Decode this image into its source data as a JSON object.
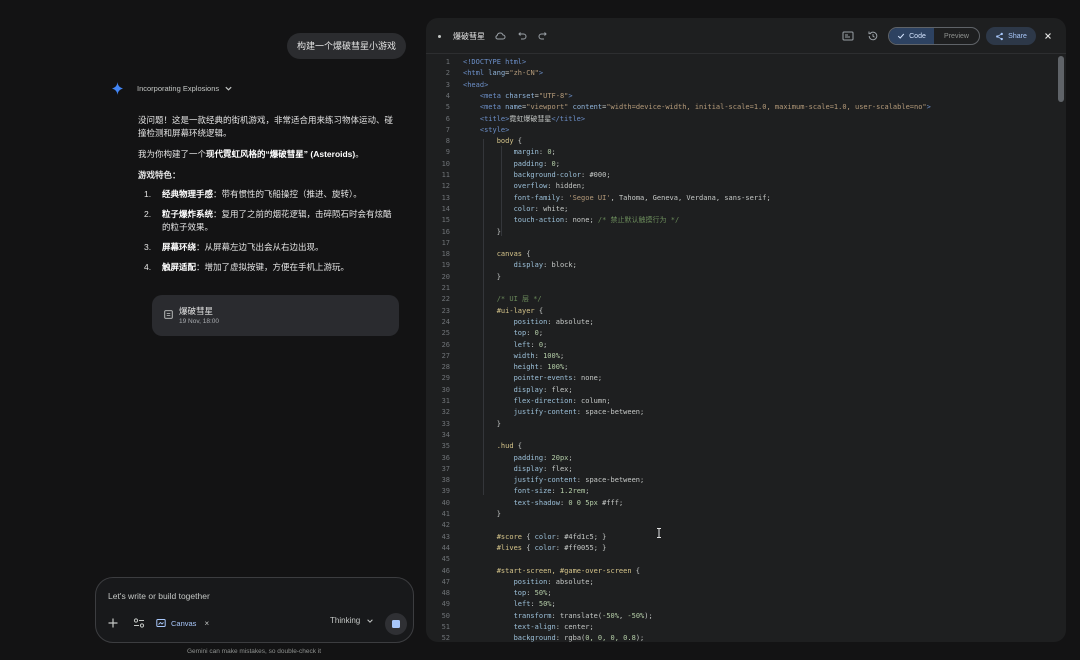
{
  "chat": {
    "user_prompt": "构建一个爆破彗星小游戏",
    "thinking_label": "Incorporating Explosions",
    "response": {
      "intro": "没问题！这是一款经典的街机游戏，非常适合用来练习物体运动、碰撞检测和屏幕环绕逻辑。",
      "lead": "我为你构建了一个",
      "lead_bold": "现代霓虹风格的“爆破彗星” (Asteroids)",
      "lead_end": "。",
      "features_heading": "游戏特色：",
      "features": [
        {
          "num": "1.",
          "title": "经典物理手感",
          "text": "：带有惯性的飞船操控（推进、旋转）。"
        },
        {
          "num": "2.",
          "title": "粒子爆炸系统",
          "text": "：复用了之前的烟花逻辑，击碎陨石时会有炫酷的粒子效果。"
        },
        {
          "num": "3.",
          "title": "屏幕环绕",
          "text": "：从屏幕左边飞出会从右边出现。"
        },
        {
          "num": "4.",
          "title": "触屏适配",
          "text": "：增加了虚拟按键，方便在手机上游玩。"
        }
      ]
    },
    "canvas_card": {
      "title": "爆破彗星",
      "date": "19 Nov, 18:00"
    },
    "input": {
      "placeholder": "Let's write or build together"
    },
    "chip_label": "Canvas",
    "mode_label": "Thinking",
    "disclaimer": "Gemini can make mistakes, so double-check it"
  },
  "editor": {
    "title": "爆破彗星",
    "tabs": {
      "code": "Code",
      "preview": "Preview"
    },
    "share_label": "Share",
    "lines": [
      [
        [
          "t-tag",
          "<!DOCTYPE html>"
        ]
      ],
      [
        [
          "t-tag",
          "<html "
        ],
        [
          "t-attr",
          "lang"
        ],
        [
          "t-pun",
          "="
        ],
        [
          "t-str",
          "\"zh-CN\""
        ],
        [
          "t-tag",
          ">"
        ]
      ],
      [
        [
          "t-tag",
          "<head>"
        ]
      ],
      [
        [
          "t-pun",
          "    "
        ],
        [
          "t-tag",
          "<meta "
        ],
        [
          "t-attr",
          "charset"
        ],
        [
          "t-pun",
          "="
        ],
        [
          "t-str",
          "\"UTF-8\""
        ],
        [
          "t-tag",
          ">"
        ]
      ],
      [
        [
          "t-pun",
          "    "
        ],
        [
          "t-tag",
          "<meta "
        ],
        [
          "t-attr",
          "name"
        ],
        [
          "t-pun",
          "="
        ],
        [
          "t-str",
          "\"viewport\""
        ],
        [
          "t-pun",
          " "
        ],
        [
          "t-attr",
          "content"
        ],
        [
          "t-pun",
          "="
        ],
        [
          "t-str",
          "\"width=device-width, initial-scale=1.0, maximum-scale=1.0, user-scalable=no\""
        ],
        [
          "t-tag",
          ">"
        ]
      ],
      [
        [
          "t-pun",
          "    "
        ],
        [
          "t-tag",
          "<title>"
        ],
        [
          "t-val",
          "霓虹爆破彗星"
        ],
        [
          "t-tag",
          "</title>"
        ]
      ],
      [
        [
          "t-pun",
          "    "
        ],
        [
          "t-tag",
          "<style>"
        ]
      ],
      [
        [
          "t-pun",
          "        "
        ],
        [
          "t-sel",
          "body"
        ],
        [
          "t-pun",
          " {"
        ]
      ],
      [
        [
          "t-pun",
          "            "
        ],
        [
          "t-prop",
          "margin"
        ],
        [
          "t-pun",
          ": "
        ],
        [
          "t-num",
          "0"
        ],
        [
          "t-pun",
          ";"
        ]
      ],
      [
        [
          "t-pun",
          "            "
        ],
        [
          "t-prop",
          "padding"
        ],
        [
          "t-pun",
          ": "
        ],
        [
          "t-num",
          "0"
        ],
        [
          "t-pun",
          ";"
        ]
      ],
      [
        [
          "t-pun",
          "            "
        ],
        [
          "t-prop",
          "background-color"
        ],
        [
          "t-pun",
          ": "
        ],
        [
          "t-val",
          "#000"
        ],
        [
          "t-pun",
          ";"
        ]
      ],
      [
        [
          "t-pun",
          "            "
        ],
        [
          "t-prop",
          "overflow"
        ],
        [
          "t-pun",
          ": "
        ],
        [
          "t-val",
          "hidden"
        ],
        [
          "t-pun",
          ";"
        ]
      ],
      [
        [
          "t-pun",
          "            "
        ],
        [
          "t-prop",
          "font-family"
        ],
        [
          "t-pun",
          ": "
        ],
        [
          "t-str",
          "'Segoe UI'"
        ],
        [
          "t-pun",
          ", "
        ],
        [
          "t-val",
          "Tahoma, Geneva, Verdana, sans-serif"
        ],
        [
          "t-pun",
          ";"
        ]
      ],
      [
        [
          "t-pun",
          "            "
        ],
        [
          "t-prop",
          "color"
        ],
        [
          "t-pun",
          ": "
        ],
        [
          "t-val",
          "white"
        ],
        [
          "t-pun",
          ";"
        ]
      ],
      [
        [
          "t-pun",
          "            "
        ],
        [
          "t-prop",
          "touch-action"
        ],
        [
          "t-pun",
          ": "
        ],
        [
          "t-val",
          "none"
        ],
        [
          "t-pun",
          "; "
        ],
        [
          "t-com",
          "/* 禁止默认触摸行为 */"
        ]
      ],
      [
        [
          "t-pun",
          "        }"
        ]
      ],
      [
        [
          "t-pun",
          ""
        ]
      ],
      [
        [
          "t-pun",
          "        "
        ],
        [
          "t-sel",
          "canvas"
        ],
        [
          "t-pun",
          " {"
        ]
      ],
      [
        [
          "t-pun",
          "            "
        ],
        [
          "t-prop",
          "display"
        ],
        [
          "t-pun",
          ": "
        ],
        [
          "t-val",
          "block"
        ],
        [
          "t-pun",
          ";"
        ]
      ],
      [
        [
          "t-pun",
          "        }"
        ]
      ],
      [
        [
          "t-pun",
          ""
        ]
      ],
      [
        [
          "t-pun",
          "        "
        ],
        [
          "t-com",
          "/* UI 层 */"
        ]
      ],
      [
        [
          "t-pun",
          "        "
        ],
        [
          "t-sel",
          "#ui-layer"
        ],
        [
          "t-pun",
          " {"
        ]
      ],
      [
        [
          "t-pun",
          "            "
        ],
        [
          "t-prop",
          "position"
        ],
        [
          "t-pun",
          ": "
        ],
        [
          "t-val",
          "absolute"
        ],
        [
          "t-pun",
          ";"
        ]
      ],
      [
        [
          "t-pun",
          "            "
        ],
        [
          "t-prop",
          "top"
        ],
        [
          "t-pun",
          ": "
        ],
        [
          "t-num",
          "0"
        ],
        [
          "t-pun",
          ";"
        ]
      ],
      [
        [
          "t-pun",
          "            "
        ],
        [
          "t-prop",
          "left"
        ],
        [
          "t-pun",
          ": "
        ],
        [
          "t-num",
          "0"
        ],
        [
          "t-pun",
          ";"
        ]
      ],
      [
        [
          "t-pun",
          "            "
        ],
        [
          "t-prop",
          "width"
        ],
        [
          "t-pun",
          ": "
        ],
        [
          "t-num",
          "100%"
        ],
        [
          "t-pun",
          ";"
        ]
      ],
      [
        [
          "t-pun",
          "            "
        ],
        [
          "t-prop",
          "height"
        ],
        [
          "t-pun",
          ": "
        ],
        [
          "t-num",
          "100%"
        ],
        [
          "t-pun",
          ";"
        ]
      ],
      [
        [
          "t-pun",
          "            "
        ],
        [
          "t-prop",
          "pointer-events"
        ],
        [
          "t-pun",
          ": "
        ],
        [
          "t-val",
          "none"
        ],
        [
          "t-pun",
          ";"
        ]
      ],
      [
        [
          "t-pun",
          "            "
        ],
        [
          "t-prop",
          "display"
        ],
        [
          "t-pun",
          ": "
        ],
        [
          "t-val",
          "flex"
        ],
        [
          "t-pun",
          ";"
        ]
      ],
      [
        [
          "t-pun",
          "            "
        ],
        [
          "t-prop",
          "flex-direction"
        ],
        [
          "t-pun",
          ": "
        ],
        [
          "t-val",
          "column"
        ],
        [
          "t-pun",
          ";"
        ]
      ],
      [
        [
          "t-pun",
          "            "
        ],
        [
          "t-prop",
          "justify-content"
        ],
        [
          "t-pun",
          ": "
        ],
        [
          "t-val",
          "space-between"
        ],
        [
          "t-pun",
          ";"
        ]
      ],
      [
        [
          "t-pun",
          "        }"
        ]
      ],
      [
        [
          "t-pun",
          ""
        ]
      ],
      [
        [
          "t-pun",
          "        "
        ],
        [
          "t-sel",
          ".hud"
        ],
        [
          "t-pun",
          " {"
        ]
      ],
      [
        [
          "t-pun",
          "            "
        ],
        [
          "t-prop",
          "padding"
        ],
        [
          "t-pun",
          ": "
        ],
        [
          "t-num",
          "20px"
        ],
        [
          "t-pun",
          ";"
        ]
      ],
      [
        [
          "t-pun",
          "            "
        ],
        [
          "t-prop",
          "display"
        ],
        [
          "t-pun",
          ": "
        ],
        [
          "t-val",
          "flex"
        ],
        [
          "t-pun",
          ";"
        ]
      ],
      [
        [
          "t-pun",
          "            "
        ],
        [
          "t-prop",
          "justify-content"
        ],
        [
          "t-pun",
          ": "
        ],
        [
          "t-val",
          "space-between"
        ],
        [
          "t-pun",
          ";"
        ]
      ],
      [
        [
          "t-pun",
          "            "
        ],
        [
          "t-prop",
          "font-size"
        ],
        [
          "t-pun",
          ": "
        ],
        [
          "t-num",
          "1.2rem"
        ],
        [
          "t-pun",
          ";"
        ]
      ],
      [
        [
          "t-pun",
          "            "
        ],
        [
          "t-prop",
          "text-shadow"
        ],
        [
          "t-pun",
          ": "
        ],
        [
          "t-num",
          "0 0 5px"
        ],
        [
          "t-pun",
          " "
        ],
        [
          "t-val",
          "#fff"
        ],
        [
          "t-pun",
          ";"
        ]
      ],
      [
        [
          "t-pun",
          "        }"
        ]
      ],
      [
        [
          "t-pun",
          ""
        ]
      ],
      [
        [
          "t-pun",
          "        "
        ],
        [
          "t-sel",
          "#score"
        ],
        [
          "t-pun",
          " { "
        ],
        [
          "t-prop",
          "color"
        ],
        [
          "t-pun",
          ": "
        ],
        [
          "t-val",
          "#4fd1c5"
        ],
        [
          "t-pun",
          "; }"
        ]
      ],
      [
        [
          "t-pun",
          "        "
        ],
        [
          "t-sel",
          "#lives"
        ],
        [
          "t-pun",
          " { "
        ],
        [
          "t-prop",
          "color"
        ],
        [
          "t-pun",
          ": "
        ],
        [
          "t-val",
          "#ff0055"
        ],
        [
          "t-pun",
          "; }"
        ]
      ],
      [
        [
          "t-pun",
          ""
        ]
      ],
      [
        [
          "t-pun",
          "        "
        ],
        [
          "t-sel",
          "#start-screen, #game-over-screen"
        ],
        [
          "t-pun",
          " {"
        ]
      ],
      [
        [
          "t-pun",
          "            "
        ],
        [
          "t-prop",
          "position"
        ],
        [
          "t-pun",
          ": "
        ],
        [
          "t-val",
          "absolute"
        ],
        [
          "t-pun",
          ";"
        ]
      ],
      [
        [
          "t-pun",
          "            "
        ],
        [
          "t-prop",
          "top"
        ],
        [
          "t-pun",
          ": "
        ],
        [
          "t-num",
          "50%"
        ],
        [
          "t-pun",
          ";"
        ]
      ],
      [
        [
          "t-pun",
          "            "
        ],
        [
          "t-prop",
          "left"
        ],
        [
          "t-pun",
          ": "
        ],
        [
          "t-num",
          "50%"
        ],
        [
          "t-pun",
          ";"
        ]
      ],
      [
        [
          "t-pun",
          "            "
        ],
        [
          "t-prop",
          "transform"
        ],
        [
          "t-pun",
          ": "
        ],
        [
          "t-val",
          "translate("
        ],
        [
          "t-num",
          "-50%"
        ],
        [
          "t-pun",
          ", "
        ],
        [
          "t-num",
          "-50%"
        ],
        [
          "t-val",
          ")"
        ],
        [
          "t-pun",
          ";"
        ]
      ],
      [
        [
          "t-pun",
          "            "
        ],
        [
          "t-prop",
          "text-align"
        ],
        [
          "t-pun",
          ": "
        ],
        [
          "t-val",
          "center"
        ],
        [
          "t-pun",
          ";"
        ]
      ],
      [
        [
          "t-pun",
          "            "
        ],
        [
          "t-prop",
          "background"
        ],
        [
          "t-pun",
          ": "
        ],
        [
          "t-val",
          "rgba("
        ],
        [
          "t-num",
          "0, 0, 0, 0.8"
        ],
        [
          "t-val",
          ")"
        ],
        [
          "t-pun",
          ";"
        ]
      ]
    ]
  }
}
